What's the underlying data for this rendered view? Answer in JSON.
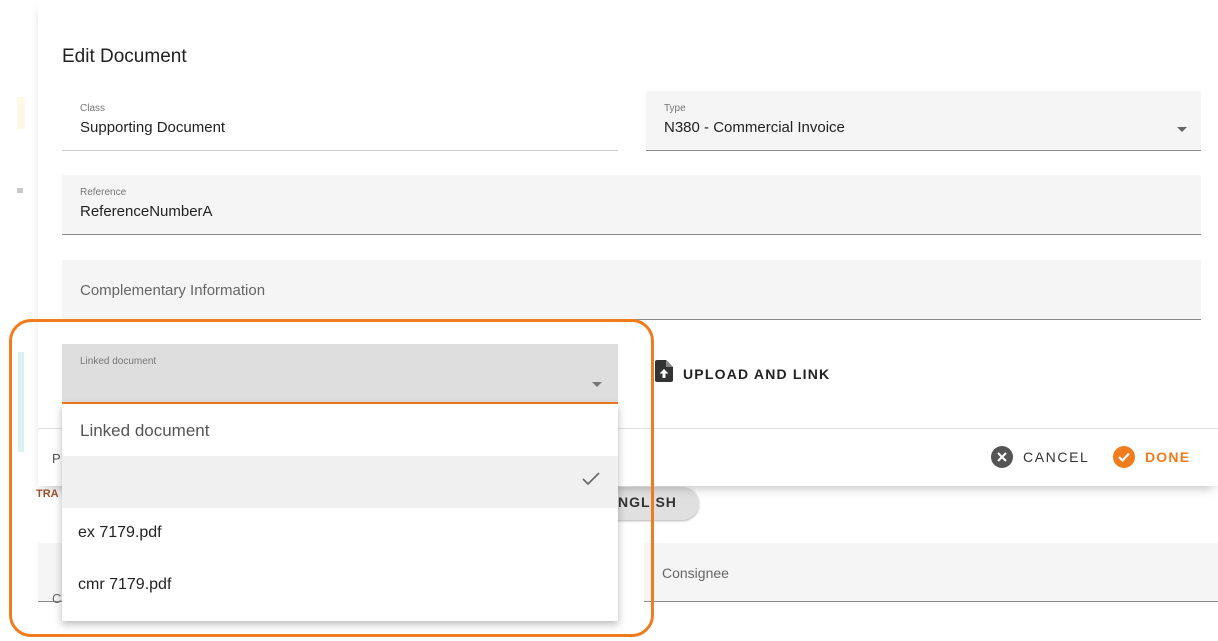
{
  "dialog": {
    "title": "Edit Document",
    "fields": {
      "class": {
        "label": "Class",
        "value": "Supporting Document"
      },
      "type": {
        "label": "Type",
        "value": "N380 - Commercial Invoice"
      },
      "reference": {
        "label": "Reference",
        "value": "ReferenceNumberA"
      },
      "complementary": {
        "placeholder": "Complementary Information"
      },
      "linked": {
        "label": "Linked document"
      }
    },
    "upload_label": "UPLOAD AND LINK",
    "partial_text": "P",
    "cancel_label": "CANCEL",
    "done_label": "DONE"
  },
  "dropdown": {
    "search_placeholder": "Linked document",
    "options": [
      {
        "label": "",
        "selected": true
      },
      {
        "label": "ex 7179.pdf",
        "selected": false
      },
      {
        "label": "cmr 7179.pdf",
        "selected": false
      }
    ]
  },
  "background": {
    "chip_text": "NGLISH",
    "tra_text": "TRA",
    "c_text": "C",
    "consignee_placeholder": "Consignee"
  },
  "colors": {
    "accent": "#f07c1d",
    "cancel_icon": "#555555"
  },
  "icons": {
    "upload": "file-upload-icon",
    "cancel": "cancel-circle-icon",
    "done": "check-circle-icon",
    "check": "check-icon"
  }
}
